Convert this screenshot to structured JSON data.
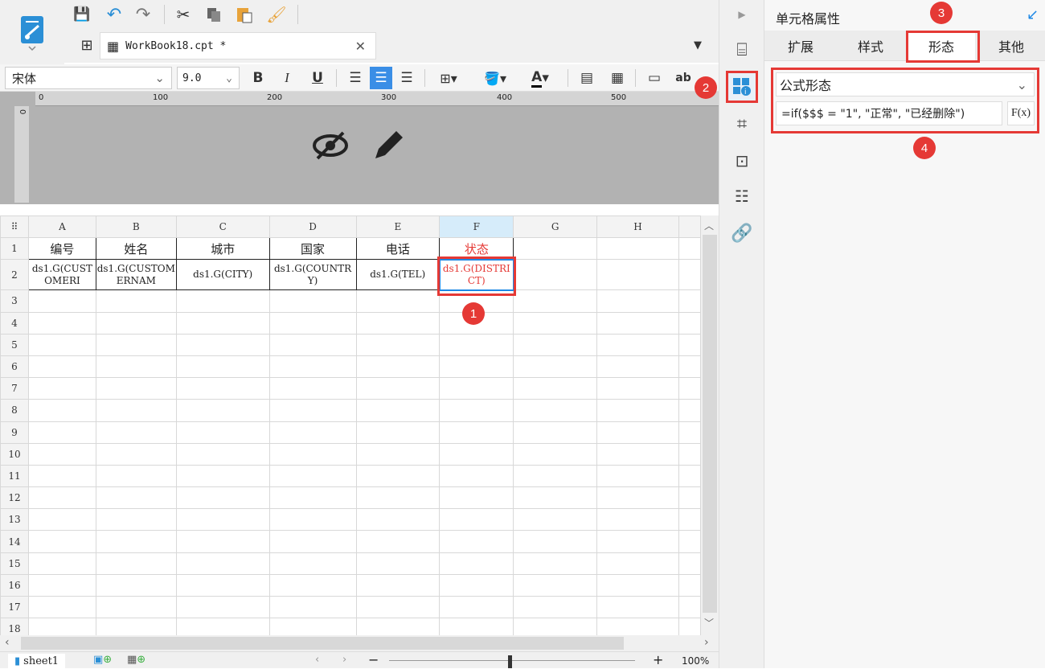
{
  "document": {
    "tab_title": "WorkBook18.cpt *",
    "sheet_name": "sheet1",
    "zoom": "100%"
  },
  "format_bar": {
    "font_family": "宋体",
    "font_size": "9.0",
    "bold": "B",
    "italic": "I",
    "underline": "U",
    "ab_label": "ab"
  },
  "ruler": {
    "ticks": [
      "0",
      "100",
      "200",
      "300",
      "400",
      "500"
    ],
    "v_tick": "0"
  },
  "grid": {
    "columns": [
      "A",
      "B",
      "C",
      "D",
      "E",
      "F",
      "G",
      "H"
    ],
    "rows": [
      "1",
      "2",
      "3",
      "4",
      "5",
      "6",
      "7",
      "8",
      "9",
      "10",
      "11",
      "12",
      "13",
      "14",
      "15",
      "16",
      "17",
      "18"
    ],
    "header_row": [
      "编号",
      "姓名",
      "城市",
      "国家",
      "电话",
      "状态"
    ],
    "data_row": [
      "ds1.G(CUSTOMERI",
      "ds1.G(CUSTOMERNAM",
      "ds1.G(CITY)",
      "ds1.G(COUNTRY)",
      "ds1.G(TEL)",
      "ds1.G(DISTRICT)"
    ]
  },
  "panel": {
    "title": "单元格属性",
    "tabs": [
      "扩展",
      "样式",
      "形态",
      "其他"
    ],
    "active_tab": "形态",
    "form_type": "公式形态",
    "formula": "=if($$$ = \"1\", \"正常\", \"已经删除\")",
    "fx_label": "F(x)"
  },
  "callouts": [
    "1",
    "2",
    "3",
    "4"
  ],
  "colors": {
    "accent": "#1e88e5",
    "annotation_red": "#e53935",
    "highlight_text": "#e53935"
  }
}
